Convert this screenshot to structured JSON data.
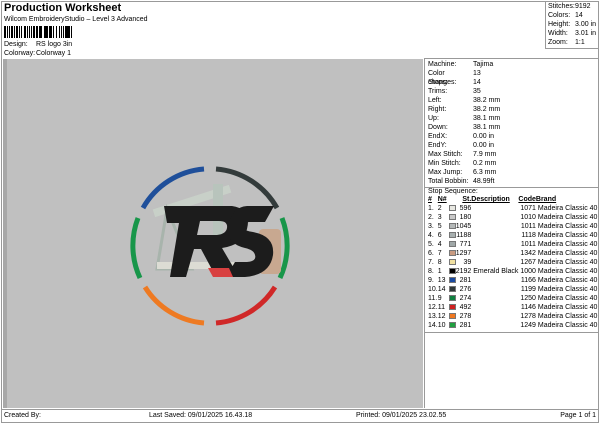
{
  "header": {
    "title": "Production Worksheet",
    "subtitle": "Wilcom EmbroideryStudio – Level 3 Advanced",
    "design_label": "Design:",
    "design": "RS logo 3in",
    "colorway_label": "Colorway:",
    "colorway": "Colorway 1"
  },
  "stats": [
    {
      "k": "Stitches:",
      "v": "9192"
    },
    {
      "k": "Colors:",
      "v": "14"
    },
    {
      "k": "Height:",
      "v": "3.00 in"
    },
    {
      "k": "Width:",
      "v": "3.01 in"
    },
    {
      "k": "Zoom:",
      "v": "1:1"
    }
  ],
  "details": [
    {
      "k": "Machine:",
      "v": "Tajima"
    },
    {
      "k": "Color changes:",
      "v": "13"
    },
    {
      "k": "Stops:",
      "v": "14"
    },
    {
      "k": "Trims:",
      "v": "35"
    },
    {
      "k": "Left:",
      "v": "38.2 mm"
    },
    {
      "k": "Right:",
      "v": "38.2 mm"
    },
    {
      "k": "Up:",
      "v": "38.1 mm"
    },
    {
      "k": "Down:",
      "v": "38.1 mm"
    },
    {
      "k": "EndX:",
      "v": "0.00 in"
    },
    {
      "k": "EndY:",
      "v": "0.00 in"
    },
    {
      "k": "Max Stitch:",
      "v": "7.9 mm"
    },
    {
      "k": "Min Stitch:",
      "v": "0.2 mm"
    },
    {
      "k": "Max Jump:",
      "v": "6.3 mm"
    },
    {
      "k": "Total Bobbin:",
      "v": "48.99ft"
    }
  ],
  "sequence": {
    "title": "Stop Sequence:",
    "headers": [
      "#",
      "N#",
      "St.",
      "Description",
      "Code",
      "Brand"
    ],
    "rows": [
      {
        "i": "1.",
        "n": "2",
        "color": "#e8e8e2",
        "st": "596",
        "desc": "",
        "code": "1071",
        "brand": "Madeira Classic 40"
      },
      {
        "i": "2.",
        "n": "3",
        "color": "#c8c8c8",
        "st": "180",
        "desc": "",
        "code": "1010",
        "brand": "Madeira Classic 40"
      },
      {
        "i": "3.",
        "n": "5",
        "color": "#b4b8b8",
        "st": "1045",
        "desc": "",
        "code": "1011",
        "brand": "Madeira Classic 40"
      },
      {
        "i": "4.",
        "n": "6",
        "color": "#a8b0b0",
        "st": "1188",
        "desc": "",
        "code": "1118",
        "brand": "Madeira Classic 40"
      },
      {
        "i": "5.",
        "n": "4",
        "color": "#a0a8a8",
        "st": "771",
        "desc": "",
        "code": "1011",
        "brand": "Madeira Classic 40"
      },
      {
        "i": "6.",
        "n": "7",
        "color": "#c89a80",
        "st": "1297",
        "desc": "",
        "code": "1342",
        "brand": "Madeira Classic 40"
      },
      {
        "i": "7.",
        "n": "8",
        "color": "#f0e0a0",
        "st": "39",
        "desc": "",
        "code": "1267",
        "brand": "Madeira Classic 40"
      },
      {
        "i": "8.",
        "n": "1",
        "color": "#000000",
        "st": "2192",
        "desc": "Emerald Black",
        "code": "1000",
        "brand": "Madeira Classic 40"
      },
      {
        "i": "9.",
        "n": "13",
        "color": "#1a4aa0",
        "st": "281",
        "desc": "",
        "code": "1166",
        "brand": "Madeira Classic 40"
      },
      {
        "i": "10.",
        "n": "14",
        "color": "#303838",
        "st": "276",
        "desc": "",
        "code": "1199",
        "brand": "Madeira Classic 40"
      },
      {
        "i": "11.",
        "n": "9",
        "color": "#108040",
        "st": "274",
        "desc": "",
        "code": "1250",
        "brand": "Madeira Classic 40"
      },
      {
        "i": "12.",
        "n": "11",
        "color": "#d02020",
        "st": "492",
        "desc": "",
        "code": "1146",
        "brand": "Madeira Classic 40"
      },
      {
        "i": "13.",
        "n": "12",
        "color": "#f07820",
        "st": "278",
        "desc": "",
        "code": "1278",
        "brand": "Madeira Classic 40"
      },
      {
        "i": "14.",
        "n": "10",
        "color": "#20a040",
        "st": "281",
        "desc": "",
        "code": "1249",
        "brand": "Madeira Classic 40"
      }
    ]
  },
  "footer": {
    "created": "Created By:",
    "saved": "Last Saved: 09/01/2025 16.43.18",
    "printed": "Printed: 09/01/2025 23.02.55",
    "page": "Page 1 of 1"
  },
  "design_preview": {
    "letters": "RS"
  }
}
